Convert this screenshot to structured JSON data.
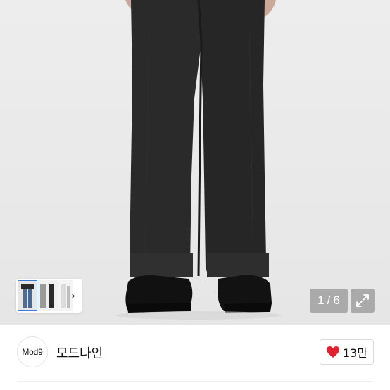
{
  "gallery": {
    "current": "1",
    "separator": "/",
    "total": "6",
    "thumb_next_glyph": "›",
    "expand_icon": "expand-icon"
  },
  "store": {
    "avatar_text": "Mod9",
    "name": "모드나인"
  },
  "like": {
    "icon": "heart-icon",
    "count": "13만",
    "color": "#e0202f"
  }
}
